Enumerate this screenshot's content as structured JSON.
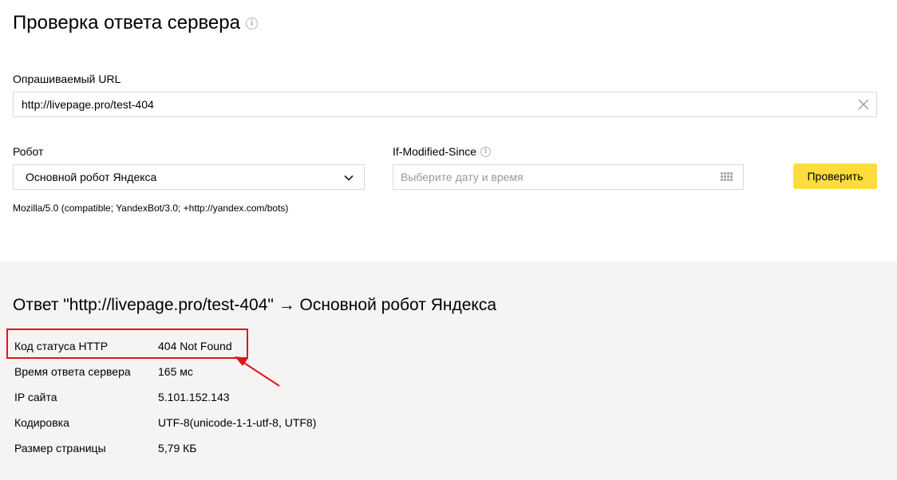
{
  "page_title": "Проверка ответа сервера",
  "url_field": {
    "label": "Опрашиваемый URL",
    "value": "http://livepage.pro/test-404"
  },
  "robot": {
    "label": "Робот",
    "selected": "Основной робот Яндекса"
  },
  "if_modified_since": {
    "label": "If-Modified-Since",
    "placeholder": "Выберите дату и время"
  },
  "check_button": "Проверить",
  "user_agent": "Mozilla/5.0 (compatible; YandexBot/3.0; +http://yandex.com/bots)",
  "result": {
    "title": "Ответ \"http://livepage.pro/test-404\" → Основной робот Яндекса",
    "rows": [
      {
        "key": "Код статуса HTTP",
        "value": "404 Not Found"
      },
      {
        "key": "Время ответа сервера",
        "value": "165 мс"
      },
      {
        "key": "IP сайта",
        "value": "5.101.152.143"
      },
      {
        "key": "Кодировка",
        "value": "UTF-8(unicode-1-1-utf-8, UTF8)"
      },
      {
        "key": "Размер страницы",
        "value": "5,79 КБ"
      }
    ]
  },
  "colors": {
    "accent_button": "#fddd3d",
    "highlight": "#e0151c",
    "result_background": "#f5f4f2"
  }
}
